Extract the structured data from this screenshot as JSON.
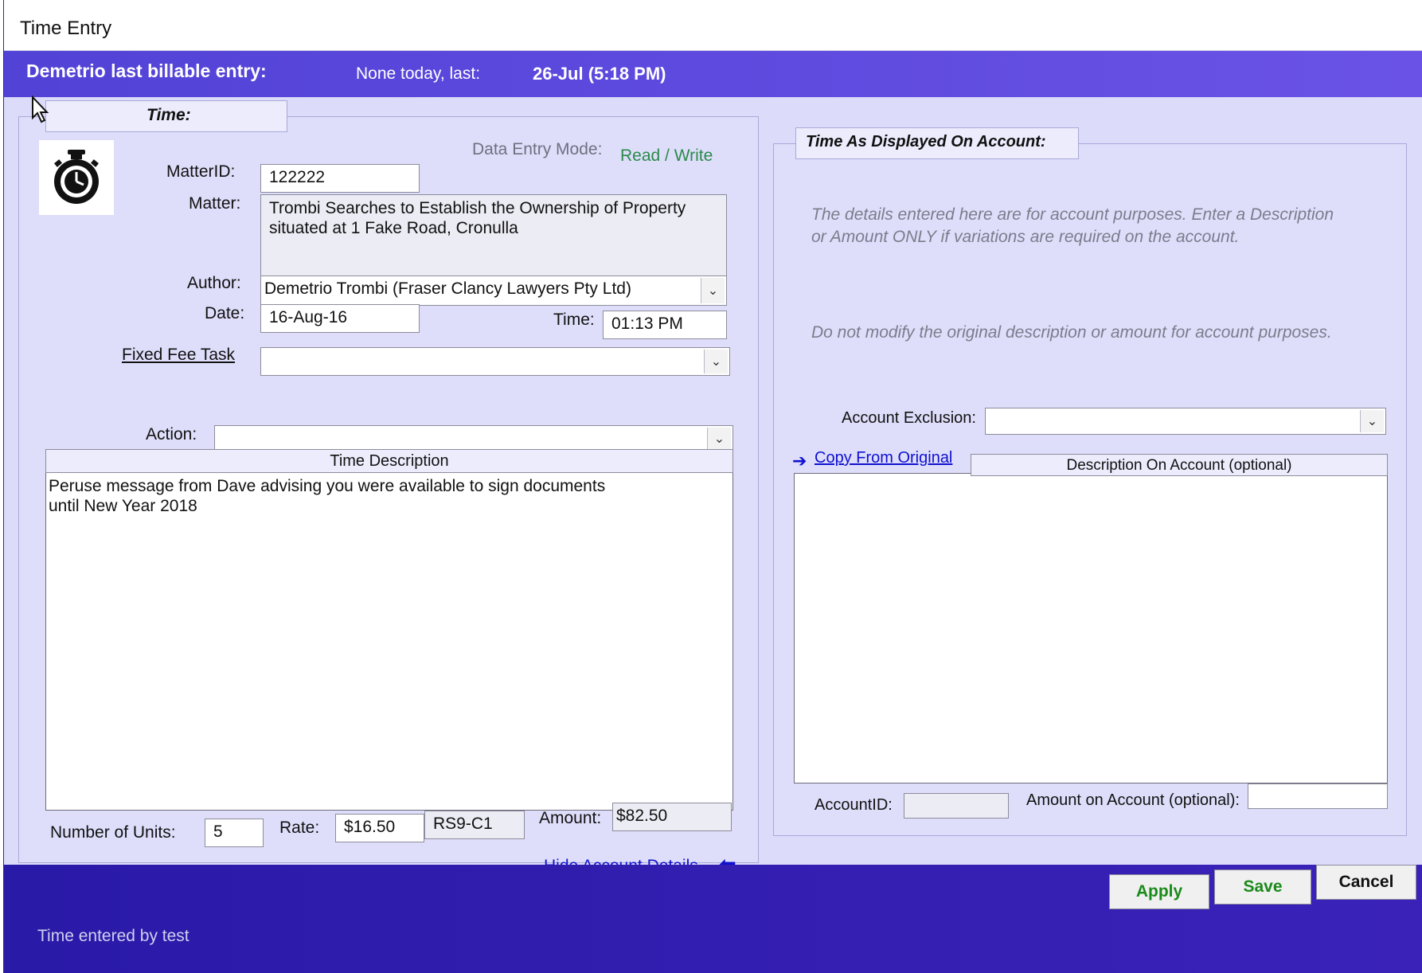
{
  "window": {
    "title": "Time Entry"
  },
  "banner": {
    "label": "Demetrio last billable entry:",
    "none_today": "None today, last:",
    "last_date": "26-Jul (5:18 PM)"
  },
  "left": {
    "frame_title": "Time:",
    "mode_label": "Data Entry Mode:",
    "mode_value": "Read / Write",
    "matter_id_label": "MatterID:",
    "matter_id": "122222",
    "matter_label": "Matter:",
    "matter": "Trombi Searches to Establish the Ownership of Property situated at 1 Fake Road, Cronulla",
    "author_label": "Author:",
    "author": "Demetrio Trombi (Fraser Clancy Lawyers Pty Ltd)",
    "date_label": "Date:",
    "date": "16-Aug-16",
    "time_label": "Time:",
    "time": "01:13 PM",
    "fixed_fee_label": "Fixed Fee Task",
    "fixed_fee_value": "",
    "action_label": "Action:",
    "action_value": "",
    "desc_header": "Time Description",
    "description": "Peruse message from Dave advising you were available to sign documents\nuntil New Year 2018",
    "units_label": "Number of Units:",
    "units": "5",
    "rate_label": "Rate:",
    "rate": "$16.50",
    "rate_code": "RS9-C1",
    "amount_label": "Amount:",
    "amount": "$82.50"
  },
  "right": {
    "frame_title": "Time As Displayed On Account:",
    "hint1": "The details entered here are for account purposes. Enter a Description or Amount ONLY if variations are required on the account.",
    "hint2": "Do not modify the original description or amount for account purposes.",
    "exclusion_label": "Account Exclusion:",
    "exclusion_value": "",
    "copy_link": "Copy From Original",
    "desc_header": "Description On Account (optional)",
    "account_id_label": "AccountID:",
    "account_id": "",
    "amount_label": "Amount on Account (optional):",
    "amount": ""
  },
  "hide_link": "Hide Account Details",
  "buttons": {
    "apply": "Apply",
    "save": "Save",
    "cancel": "Cancel"
  },
  "footer": "Time entered by test",
  "colors": {
    "banner": "#5242d6",
    "footer": "#2a1aa8",
    "mode_value": "#2a8a4a",
    "link": "#1010d0"
  },
  "icons": [
    "stopwatch-icon",
    "dropdown-arrow-icon",
    "arrow-right-icon",
    "arrow-left-icon",
    "mouse-cursor-icon"
  ]
}
